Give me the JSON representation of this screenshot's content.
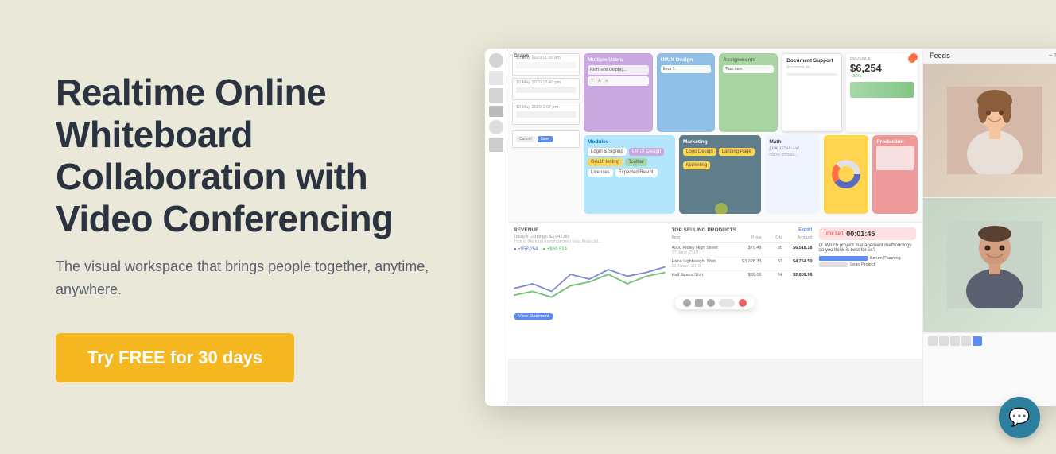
{
  "hero": {
    "headline": "Realtime Online Whiteboard Collaboration with Video Conferencing",
    "subheadline": "The visual workspace that brings people together, anytime, anywhere.",
    "cta_label": "Try FREE for 30 days"
  },
  "app": {
    "feeds_title": "Feeds",
    "revenue_label": "REVENUE",
    "revenue_amount": "$6,254",
    "chart_label1": "● +$58,254",
    "chart_label2": "● +$69,524",
    "products_title": "TOP SELLING PRODUCTS",
    "timer_label": "Time Left",
    "timer_value": "00:01:45",
    "kanban": {
      "col1_title": "Multiple Users",
      "col2_title": "UI/UX Design",
      "col3_title": "Assignments",
      "col4_title": "Document Support",
      "col5_title": "Modules",
      "col6_title": "Marketing",
      "col7_title": "Math",
      "col8_title": "Graph",
      "col9_title": "Production"
    },
    "products": [
      {
        "name": "4000 Ridley High Street",
        "price": "$79.49"
      },
      {
        "name": "Hana Lightweight Shirt",
        "price": "$3,028.33"
      },
      {
        "name": "Half Space Shirt",
        "price": "$39.08"
      }
    ]
  },
  "chat": {
    "icon": "💬"
  },
  "colors": {
    "bg": "#eae8d8",
    "headline": "#2c3340",
    "subheadline": "#5a6070",
    "cta_bg": "#f5b820",
    "cta_text": "#ffffff",
    "chat_bubble": "#2d7f9e"
  }
}
